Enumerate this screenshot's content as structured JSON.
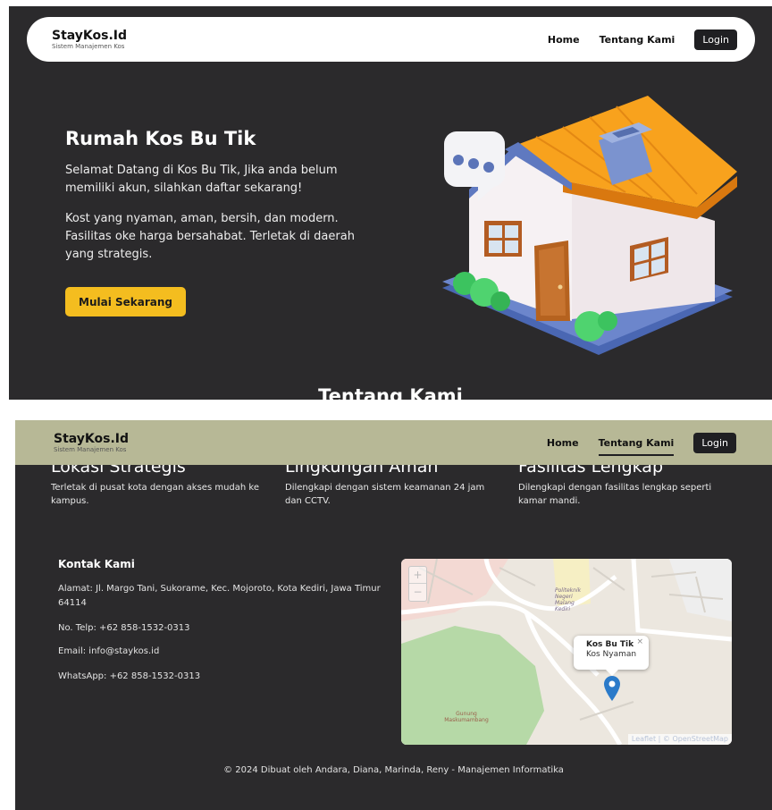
{
  "brand": {
    "title": "StayKos.Id",
    "subtitle": "Sistem Manajemen Kos"
  },
  "nav": {
    "home": "Home",
    "about": "Tentang Kami",
    "login": "Login"
  },
  "hero": {
    "title": "Rumah Kos Bu Tik",
    "welcome": "Selamat Datang di Kos Bu Tik, Jika anda belum memiliki akun, silahkan daftar sekarang!",
    "description": "Kost yang nyaman, aman, bersih, dan modern. Fasilitas oke harga bersahabat. Terletak di daerah yang strategis.",
    "cta": "Mulai Sekarang",
    "illustration": "house-illustration"
  },
  "section_peek": "Tentang Kami",
  "features": [
    {
      "title": "Lokasi Strategis",
      "desc": "Terletak di pusat kota dengan akses mudah ke kampus."
    },
    {
      "title": "Lingkungan Aman",
      "desc": "Dilengkapi dengan sistem keamanan 24 jam dan CCTV."
    },
    {
      "title": "Fasilitas Lengkap",
      "desc": "Dilengkapi dengan fasilitas lengkap seperti kamar mandi."
    }
  ],
  "contact": {
    "title": "Kontak Kami",
    "address": "Alamat: Jl. Margo Tani, Sukorame, Kec. Mojoroto, Kota Kediri, Jawa Timur 64114",
    "phone": "No. Telp: +62 858-1532-0313",
    "email": "Email: info@staykos.id",
    "whatsapp": "WhatsApp: +62 858-1532-0313"
  },
  "map": {
    "zoom_in": "+",
    "zoom_out": "−",
    "popup_title": "Kos Bu Tik",
    "popup_sub": "Kos Nyaman",
    "popup_close": "×",
    "label_a": "Politeknik Negeri Malang Kediri",
    "label_b": "Gunung Maskumambang",
    "attribution": "Leaflet | © OpenStreetMap"
  },
  "footer": "© 2024 Dibuat oleh Andara, Diana, Marinda, Reny - Manajemen Informatika",
  "colors": {
    "dark_bg": "#2b2a2c",
    "accent": "#f4bd1f",
    "nav2_bg": "#b7b896",
    "marker": "#2a7ac9"
  }
}
